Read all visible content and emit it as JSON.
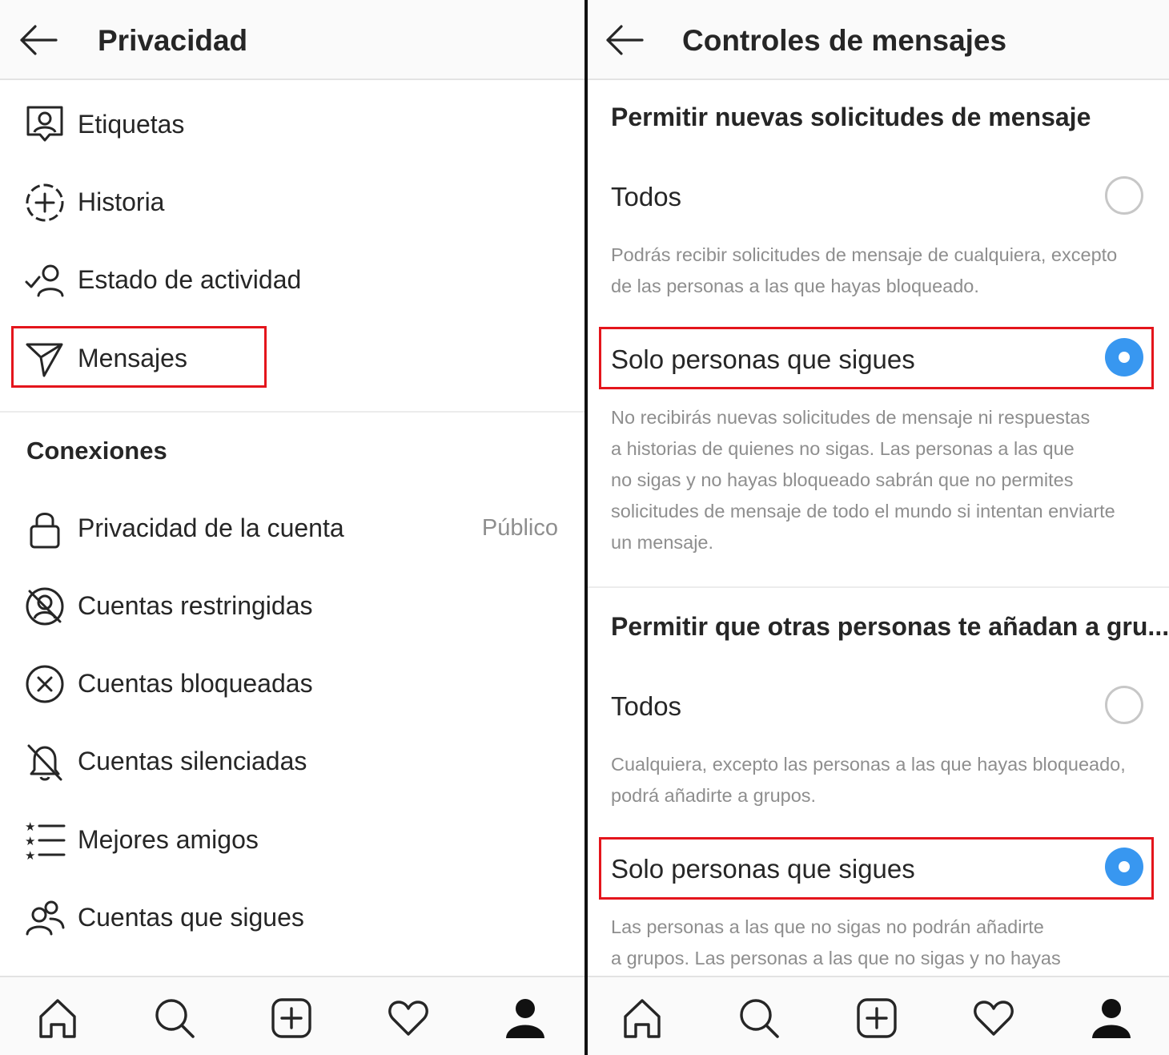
{
  "left": {
    "header": {
      "title": "Privacidad"
    },
    "items": [
      {
        "label": "Etiquetas"
      },
      {
        "label": "Historia"
      },
      {
        "label": "Estado de actividad"
      },
      {
        "label": "Mensajes"
      }
    ],
    "section_title": "Conexiones",
    "connections": [
      {
        "label": "Privacidad de la cuenta",
        "value": "Público"
      },
      {
        "label": "Cuentas restringidas"
      },
      {
        "label": "Cuentas bloqueadas"
      },
      {
        "label": "Cuentas silenciadas"
      },
      {
        "label": "Mejores amigos"
      },
      {
        "label": "Cuentas que sigues"
      }
    ]
  },
  "right": {
    "header": {
      "title": "Controles de mensajes"
    },
    "sections": [
      {
        "heading": "Permitir nuevas solicitudes de mensaje",
        "options": [
          {
            "label": "Todos",
            "selected": false,
            "description": [
              "Podrás recibir solicitudes de mensaje de cualquiera, excepto",
              "de las personas a las que hayas bloqueado."
            ]
          },
          {
            "label": "Solo personas que sigues",
            "selected": true,
            "description": [
              "No recibirás nuevas solicitudes de mensaje ni respuestas",
              "a historias de quienes no sigas. Las personas a las que",
              "no sigas y no hayas bloqueado sabrán que no permites",
              "solicitudes de mensaje de todo el mundo si intentan enviarte",
              "un mensaje."
            ]
          }
        ]
      },
      {
        "heading": "Permitir que otras personas te añadan a gru...",
        "options": [
          {
            "label": "Todos",
            "selected": false,
            "description": [
              "Cualquiera, excepto las personas a las que hayas bloqueado,",
              "podrá añadirte a grupos."
            ]
          },
          {
            "label": "Solo personas que sigues",
            "selected": true,
            "description": [
              "Las personas a las que no sigas no podrán añadirte",
              "a grupos. Las personas a las que no sigas y no hayas"
            ]
          }
        ]
      }
    ]
  },
  "tabbar": {
    "icons": [
      "home-icon",
      "search-icon",
      "new-post-icon",
      "activity-heart-icon",
      "profile-icon"
    ]
  },
  "colors": {
    "highlight": "#e4151c",
    "radio_selected": "#3897f0",
    "secondary_text": "#8e8e8e"
  }
}
